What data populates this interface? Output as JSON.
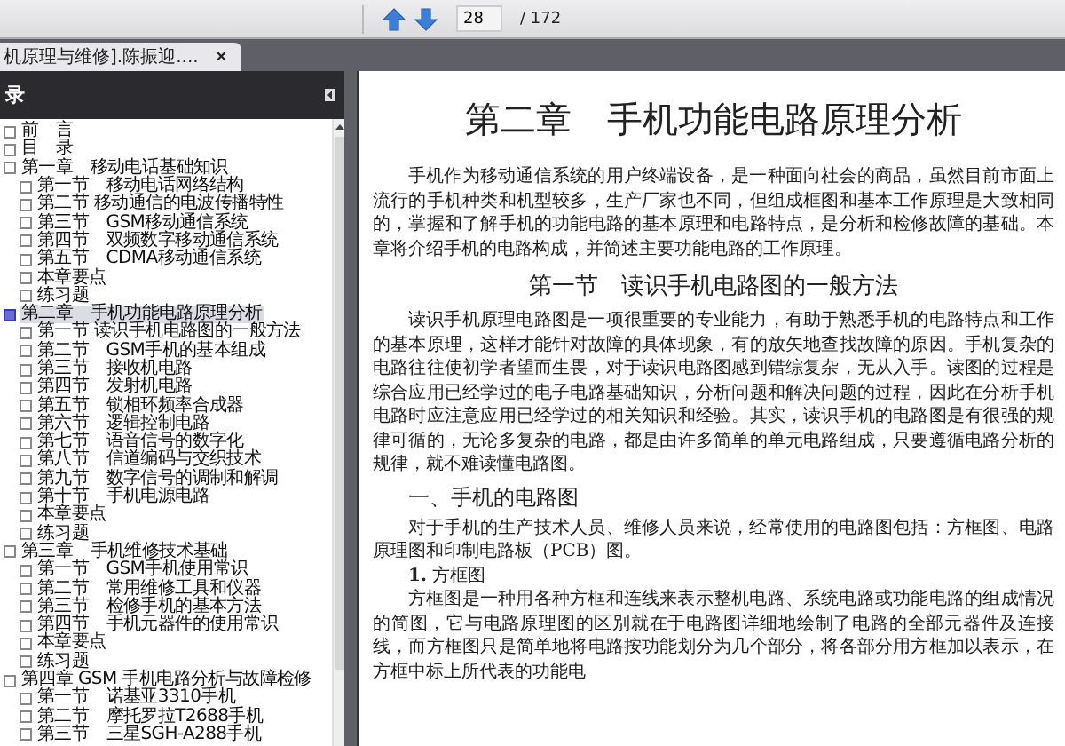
{
  "toolbar": {
    "page": "28",
    "total": "/ 172"
  },
  "tab": {
    "title": "机原理与维修].陈振迎....",
    "close": "×",
    "selected": true
  },
  "sidebar": {
    "title": "录",
    "items": [
      {
        "label": "前　言",
        "selected": false
      },
      {
        "label": "目　录",
        "selected": false
      },
      {
        "label": "第一章　移动电话基础知识",
        "selected": false,
        "children": [
          {
            "label": "第一节　移动电话网络结构",
            "selected": false
          },
          {
            "label": "第二节 移动通信的电波传播特性",
            "selected": false
          },
          {
            "label": "第三节　GSM移动通信系统",
            "selected": false
          },
          {
            "label": "第四节　双频数字移动通信系统",
            "selected": false
          },
          {
            "label": "第五节　CDMA移动通信系统",
            "selected": false
          },
          {
            "label": "本章要点",
            "selected": false
          },
          {
            "label": "练习题",
            "selected": false
          }
        ]
      },
      {
        "label": "第二章　手机功能电路原理分析",
        "selected": true,
        "children": [
          {
            "label": "第一节 读识手机电路图的一般方法",
            "selected": false
          },
          {
            "label": "第二节　GSM手机的基本组成",
            "selected": false
          },
          {
            "label": "第三节　接收机电路",
            "selected": false
          },
          {
            "label": "第四节　发射机电路",
            "selected": false
          },
          {
            "label": "第五节　锁相环频率合成器",
            "selected": false
          },
          {
            "label": "第六节　逻辑控制电路",
            "selected": false
          },
          {
            "label": "第七节　语音信号的数字化",
            "selected": false
          },
          {
            "label": "第八节　信道编码与交织技术",
            "selected": false
          },
          {
            "label": "第九节　数字信号的调制和解调",
            "selected": false
          },
          {
            "label": "第十节　手机电源电路",
            "selected": false
          },
          {
            "label": "本章要点",
            "selected": false
          },
          {
            "label": "练习题",
            "selected": false
          }
        ]
      },
      {
        "label": "第三章　手机维修技术基础",
        "selected": false,
        "children": [
          {
            "label": "第一节　GSM手机使用常识",
            "selected": false
          },
          {
            "label": "第二节　常用维修工具和仪器",
            "selected": false
          },
          {
            "label": "第三节　检修手机的基本方法",
            "selected": false
          },
          {
            "label": "第四节　手机元器件的使用常识",
            "selected": false
          },
          {
            "label": "本章要点",
            "selected": false
          },
          {
            "label": "练习题",
            "selected": false
          }
        ]
      },
      {
        "label": "第四章 GSM 手机电路分析与故障检修",
        "selected": false,
        "children": [
          {
            "label": "第一节　诺基亚3310手机",
            "selected": false
          },
          {
            "label": "第二节　摩托罗拉T2688手机",
            "selected": false
          },
          {
            "label": "第三节　三星SGH-A288手机",
            "selected": false
          }
        ]
      }
    ]
  },
  "document": {
    "blocks": [
      {
        "kind": "chapter",
        "text": "第二章　手机功能电路原理分析"
      },
      {
        "kind": "paragraph",
        "text": "手机作为移动通信系统的用户终端设备，是一种面向社会的商品，虽然目前市面上流行的手机种类和机型较多，生产厂家也不同，但组成框图和基本工作原理是大致相同的，掌握和了解手机的功能电路的基本原理和电路特点，是分析和检修故障的基础。本章将介绍手机的电路构成，并简述主要功能电路的工作原理。"
      },
      {
        "kind": "section",
        "text": "第一节　读识手机电路图的一般方法"
      },
      {
        "kind": "paragraph",
        "text": "读识手机原理电路图是一项很重要的专业能力，有助于熟悉手机的电路特点和工作的基本原理，这样才能针对故障的具体现象，有的放矢地查找故障的原因。手机复杂的电路往往使初学者望而生畏，对于读识电路图感到错综复杂，无从入手。读图的过程是综合应用已经学过的电子电路基础知识，分析问题和解决问题的过程，因此在分析手机电路时应注意应用已经学过的相关知识和经验。其实，读识手机的电路图是有很强的规律可循的，无论多复杂的电路，都是由许多简单的单元电路组成，只要遵循电路分析的规律，就不难读懂电路图。"
      },
      {
        "kind": "subhead",
        "text": "一、手机的电路图"
      },
      {
        "kind": "paragraph",
        "text": "对于手机的生产技术人员、维修人员来说，经常使用的电路图包括：方框图、电路原理图和印制电路板（PCB）图。"
      },
      {
        "kind": "item",
        "text": "**1.** 方框图"
      },
      {
        "kind": "paragraph",
        "text": "方框图是一种用各种方框和连线来表示整机电路、系统电路或功能电路的组成情况的简图，它与电路原理图的区别就在于电路图详细地绘制了电路的全部元器件及连接线，而方框图只是简单地将电路按功能划分为几个部分，将各部分用方框加以表示，在方框中标上所代表的功能电"
      }
    ]
  }
}
